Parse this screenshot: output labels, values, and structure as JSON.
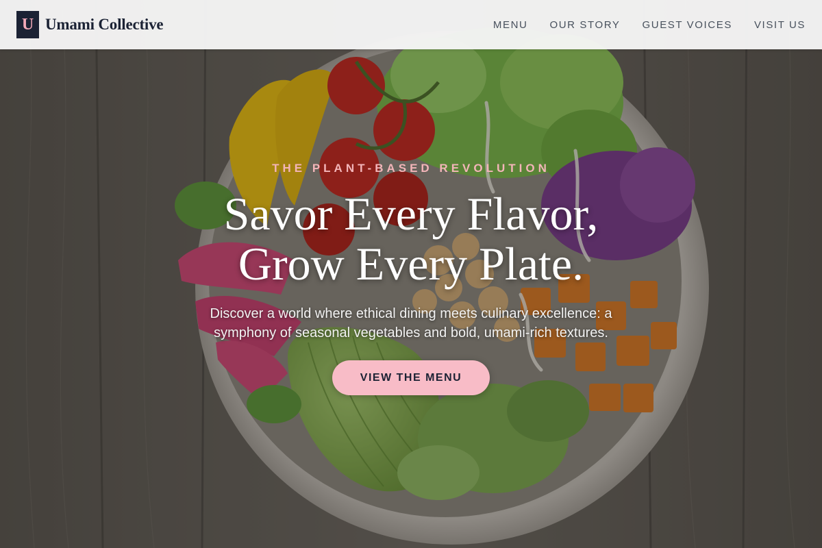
{
  "brand": {
    "logo_letter": "U",
    "name": "Umami Collective"
  },
  "nav": {
    "items": [
      {
        "label": "MENU"
      },
      {
        "label": "OUR STORY"
      },
      {
        "label": "GUEST VOICES"
      },
      {
        "label": "VISIT US"
      }
    ]
  },
  "hero": {
    "eyebrow": "THE PLANT-BASED REVOLUTION",
    "headline_line1": "Savor Every Flavor,",
    "headline_line2": "Grow Every Plate.",
    "subtext_line1": "Discover a world where ethical dining meets culinary excellence: a",
    "subtext_line2": "symphony of seasonal vegetables and bold, umami-rich textures.",
    "cta_label": "VIEW THE MENU",
    "image_icon": "salad-bowl-photo"
  },
  "colors": {
    "brand_navy": "#1b2234",
    "accent_pink": "#f8bcc7",
    "eyebrow_pink": "#f3b5b9",
    "header_bg": "#f6f6f6",
    "nav_text": "#47505c"
  }
}
